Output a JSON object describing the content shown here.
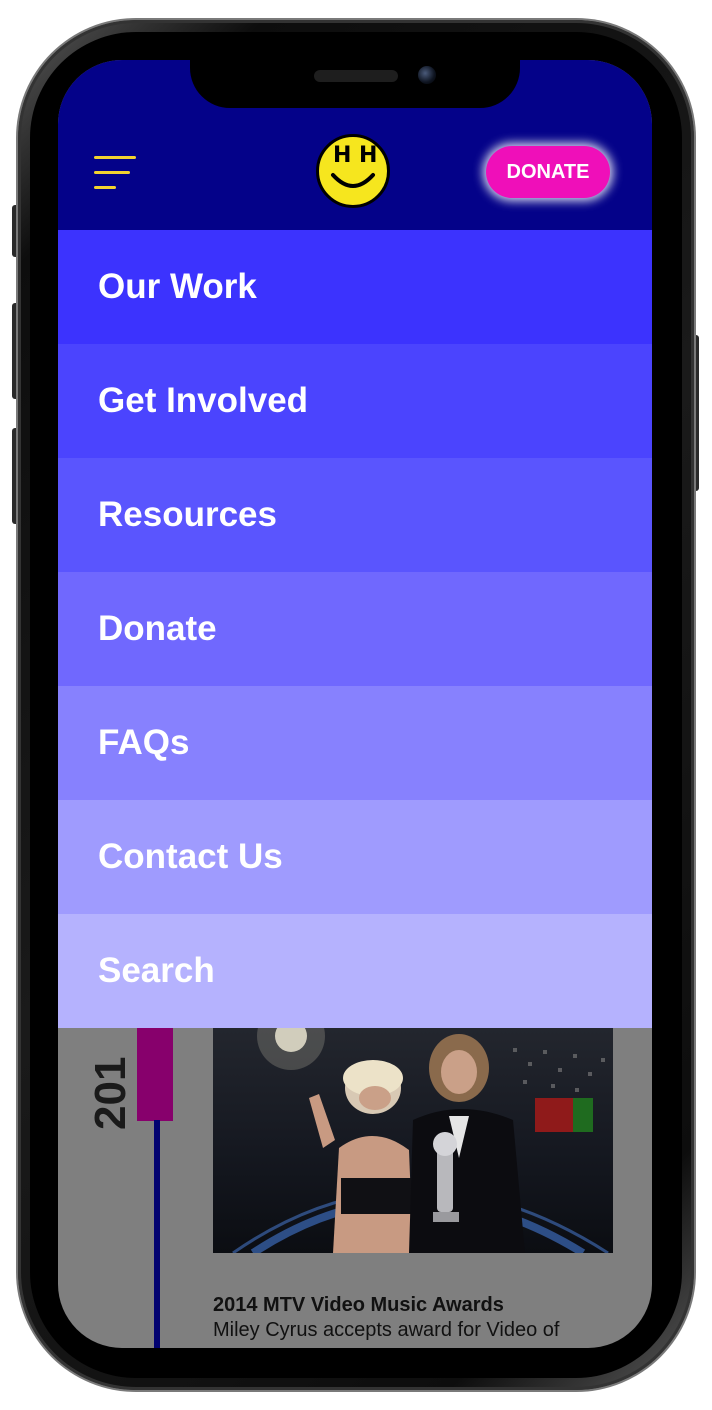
{
  "header": {
    "logo_letters": [
      "H",
      "H"
    ],
    "donate_label": "DONATE",
    "colors": {
      "background": "#040289",
      "donate": "#ef0fb9",
      "hamburger": "#f2d230",
      "logo": "#f6e61e"
    }
  },
  "menu": {
    "items": [
      {
        "label": "Our Work",
        "color": "#3c33fe"
      },
      {
        "label": "Get Involved",
        "color": "#4b44fe"
      },
      {
        "label": "Resources",
        "color": "#5a55fe"
      },
      {
        "label": "Donate",
        "color": "#7068fe"
      },
      {
        "label": "FAQs",
        "color": "#8781fe"
      },
      {
        "label": "Contact Us",
        "color": "#9f9bfe"
      },
      {
        "label": "Search",
        "color": "#b5b2fe"
      }
    ]
  },
  "background_content": {
    "year": "201",
    "caption_title": "2014 MTV Video Music Awards",
    "caption_body": "Miley Cyrus accepts award for Video of",
    "colors": {
      "overlay": "#7f7f7f",
      "timeline_marker": "#87006c",
      "timeline_line": "#020270"
    }
  }
}
